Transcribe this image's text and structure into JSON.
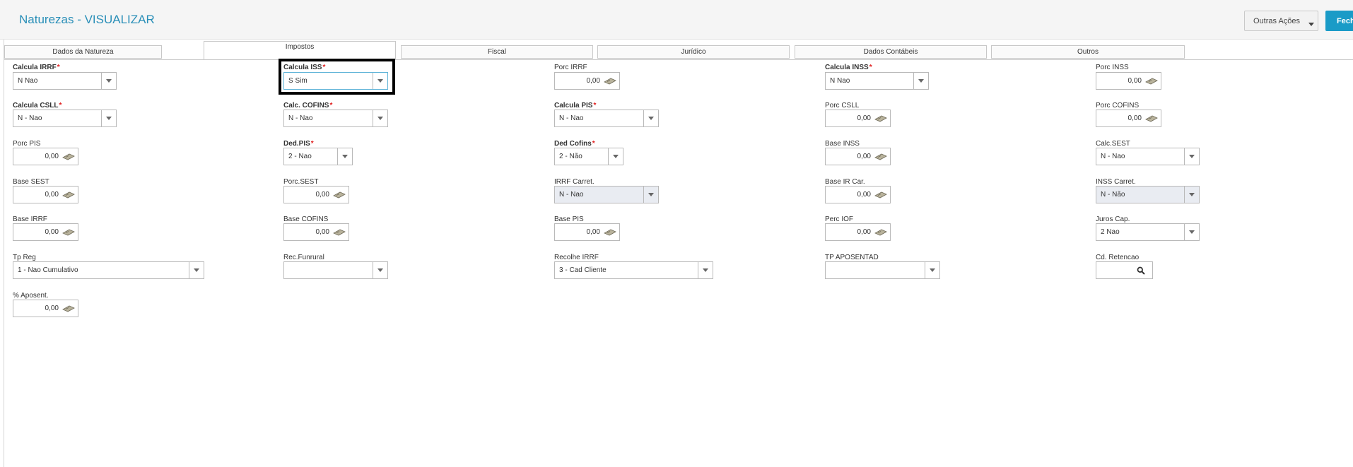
{
  "header": {
    "title": "Naturezas - VISUALIZAR",
    "outras_acoes": "Outras Ações",
    "fechar": "Fech"
  },
  "tabs": [
    "Dados da Natureza",
    "Impostos",
    "Fiscal",
    "Jurídico",
    "Dados Contábeis",
    "Outros"
  ],
  "fields": {
    "calcula_irrf": {
      "label": "Calcula IRRF",
      "value": "N   Nao"
    },
    "calcula_iss": {
      "label": "Calcula ISS",
      "value": "S   Sim"
    },
    "porc_irrf": {
      "label": "Porc IRRF",
      "value": "0,00"
    },
    "calcula_inss": {
      "label": "Calcula INSS",
      "value": "N   Nao"
    },
    "porc_inss": {
      "label": "Porc INSS",
      "value": "0,00"
    },
    "calcula_csll": {
      "label": "Calcula CSLL",
      "value": "N - Nao"
    },
    "calc_cofins": {
      "label": "Calc. COFINS",
      "value": "N - Nao"
    },
    "calcula_pis": {
      "label": "Calcula PIS",
      "value": "N - Nao"
    },
    "porc_csll": {
      "label": "Porc CSLL",
      "value": "0,00"
    },
    "porc_cofins": {
      "label": "Porc COFINS",
      "value": "0,00"
    },
    "porc_pis": {
      "label": "Porc PIS",
      "value": "0,00"
    },
    "ded_pis": {
      "label": "Ded.PIS",
      "value": "2 - Nao"
    },
    "ded_cofins": {
      "label": "Ded Cofins",
      "value": "2 - Não"
    },
    "base_inss": {
      "label": "Base INSS",
      "value": "0,00"
    },
    "calc_sest": {
      "label": "Calc.SEST",
      "value": "N - Nao"
    },
    "base_sest": {
      "label": "Base SEST",
      "value": "0,00"
    },
    "porc_sest": {
      "label": "Porc.SEST",
      "value": "0,00"
    },
    "irrf_carret": {
      "label": "IRRF Carret.",
      "value": "N - Nao"
    },
    "base_ir_car": {
      "label": "Base IR Car.",
      "value": "0,00"
    },
    "inss_carret": {
      "label": "INSS Carret.",
      "value": "N - Não"
    },
    "base_irrf": {
      "label": "Base IRRF",
      "value": "0,00"
    },
    "base_cofins": {
      "label": "Base COFINS",
      "value": "0,00"
    },
    "base_pis": {
      "label": "Base PIS",
      "value": "0,00"
    },
    "perc_iof": {
      "label": "Perc IOF",
      "value": "0,00"
    },
    "juros_cap": {
      "label": "Juros Cap.",
      "value": "2   Nao"
    },
    "tp_reg": {
      "label": "Tp Reg",
      "value": "1 - Nao Cumulativo"
    },
    "rec_funrural": {
      "label": "Rec.Funrural",
      "value": ""
    },
    "recolhe_irrf": {
      "label": "Recolhe IRRF",
      "value": "3 - Cad Cliente"
    },
    "tp_aposentad": {
      "label": "TP APOSENTAD",
      "value": ""
    },
    "cd_retencao": {
      "label": "Cd. Retencao",
      "value": ""
    },
    "perc_aposent": {
      "label": "% Aposent.",
      "value": "0,00"
    }
  },
  "required_mark": "*",
  "colors": {
    "title": "#2a8fb8",
    "primary_button": "#1a9bc7",
    "required": "#e02020",
    "disabled_field": "#e9ecf2"
  }
}
